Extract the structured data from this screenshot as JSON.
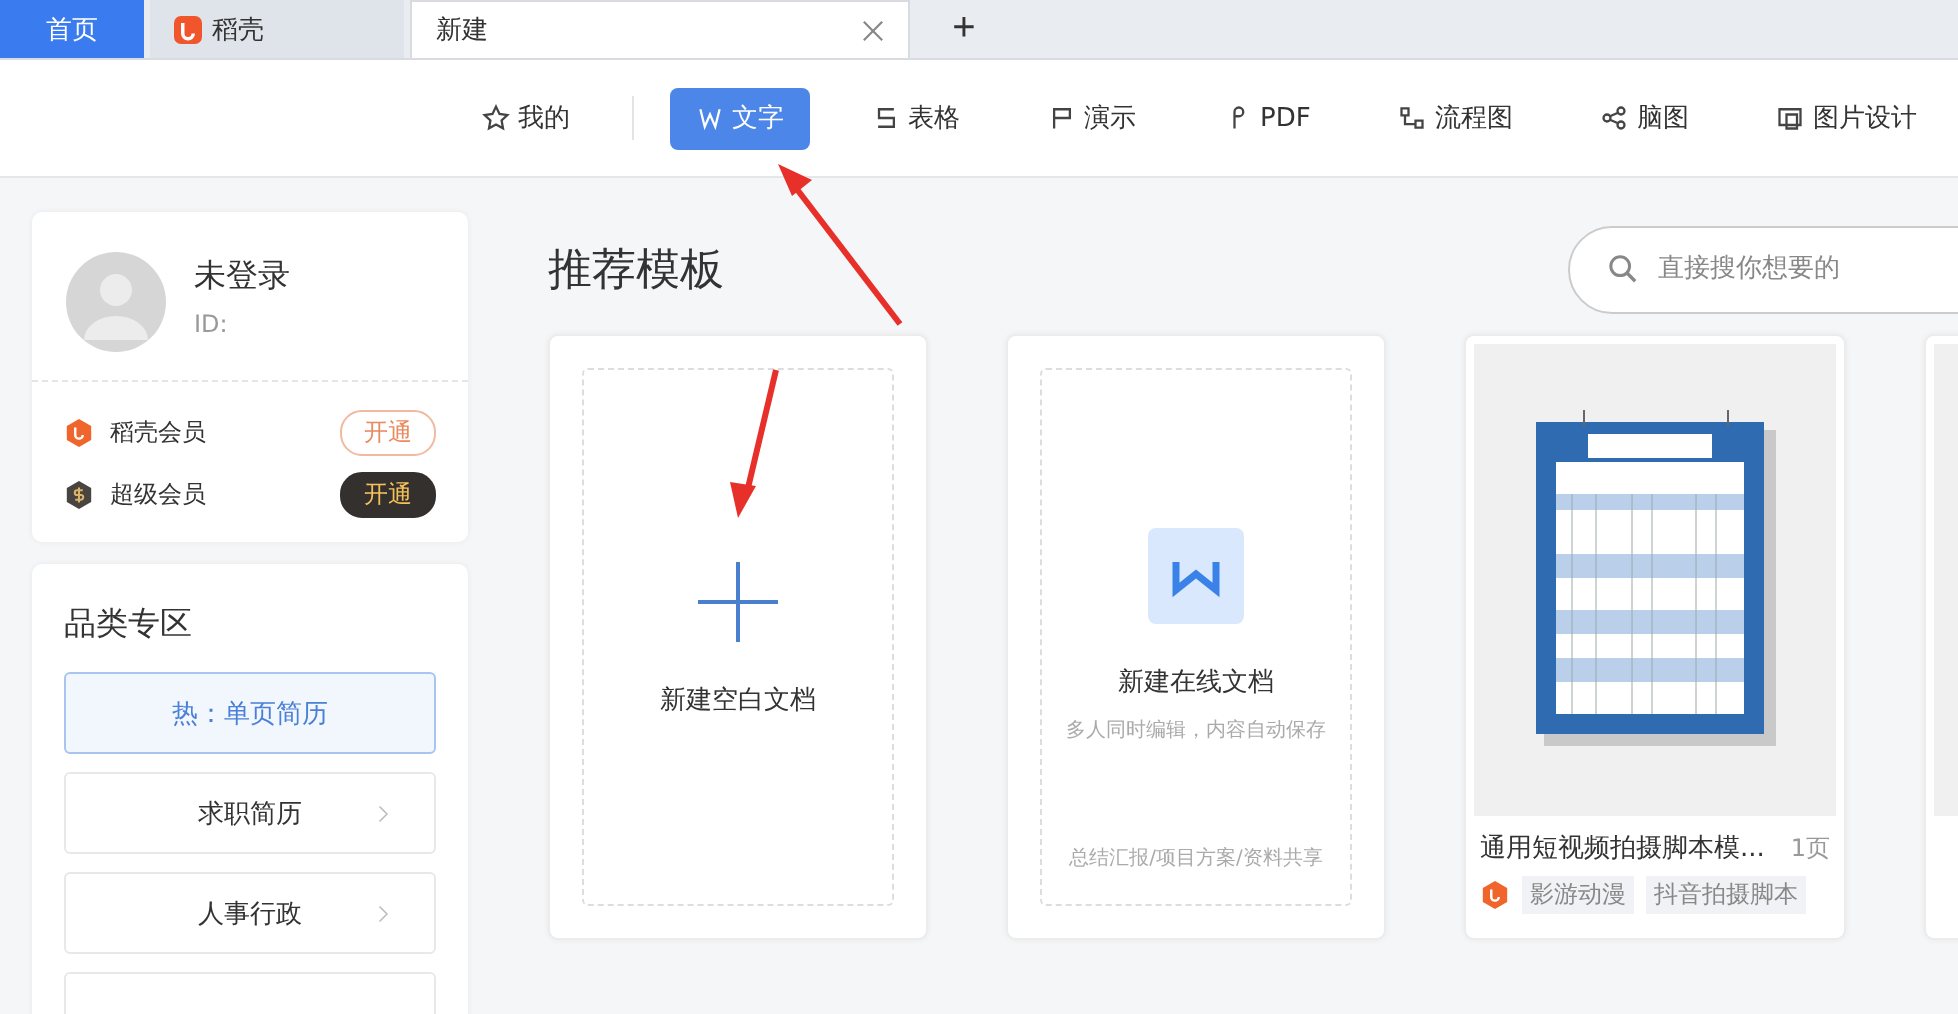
{
  "tabs": [
    {
      "label": "首页",
      "kind": "home",
      "selected": false
    },
    {
      "label": "稻壳",
      "kind": "app",
      "selected": false
    },
    {
      "label": "新建",
      "kind": "doc",
      "selected": true
    }
  ],
  "new_tab_button": "+",
  "nav": [
    {
      "label": "我的",
      "kind": "star",
      "selected": false
    },
    {
      "label": "文字",
      "kind": "w",
      "selected": true
    },
    {
      "label": "表格",
      "kind": "s",
      "selected": false
    },
    {
      "label": "演示",
      "kind": "p",
      "selected": false
    },
    {
      "label": "PDF",
      "kind": "pdf",
      "selected": false
    },
    {
      "label": "流程图",
      "kind": "flow",
      "selected": false
    },
    {
      "label": "脑图",
      "kind": "mind",
      "selected": false
    },
    {
      "label": "图片设计",
      "kind": "image",
      "selected": false
    }
  ],
  "profile": {
    "name": "未登录",
    "id_label": "ID:"
  },
  "memberships": [
    {
      "name": "稻壳会员",
      "action": "开通",
      "kind": "docer"
    },
    {
      "name": "超级会员",
      "action": "开通",
      "kind": "super"
    }
  ],
  "categories": {
    "title": "品类专区",
    "items": [
      {
        "label": "热：单页简历",
        "selected": true
      },
      {
        "label": "求职简历",
        "selected": false
      },
      {
        "label": "人事行政",
        "selected": false
      }
    ]
  },
  "section_title": "推荐模板",
  "search": {
    "placeholder": "直接搜你想要的"
  },
  "create_cards": [
    {
      "kind": "blank",
      "title": "新建空白文档"
    },
    {
      "kind": "online",
      "title": "新建在线文档",
      "subtitle": "多人同时编辑，内容自动保存",
      "footer": "总结汇报/项目方案/资料共享"
    }
  ],
  "templates": [
    {
      "title": "通用短视频拍摄脚本模...",
      "pages": "1页",
      "tags": [
        "影游动漫",
        "抖音拍摄脚本"
      ]
    }
  ]
}
